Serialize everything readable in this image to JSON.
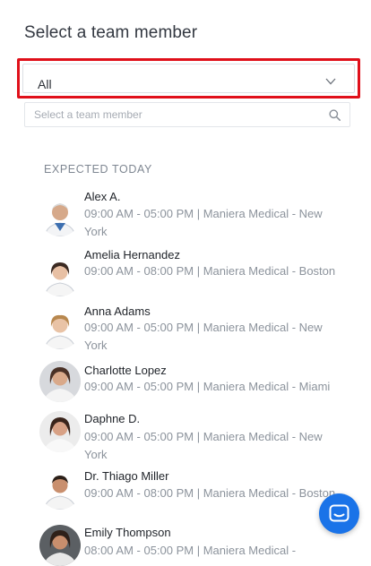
{
  "title": "Select a team member",
  "select": {
    "value": "All",
    "icon": "chevron-down-icon"
  },
  "search": {
    "placeholder": "Select a team member",
    "icon": "search-icon"
  },
  "section_label": "EXPECTED TODAY",
  "members": [
    {
      "name": "Alex A.",
      "detail": "09:00 AM - 05:00 PM | Maniera Medical - New York"
    },
    {
      "name": "Amelia Hernandez",
      "detail": "09:00 AM - 08:00 PM | Maniera Medical - Boston"
    },
    {
      "name": "Anna Adams",
      "detail": "09:00 AM - 05:00 PM | Maniera Medical - New York"
    },
    {
      "name": "Charlotte Lopez",
      "detail": "09:00 AM - 05:00 PM | Maniera Medical - Miami"
    },
    {
      "name": "Daphne D.",
      "detail": "09:00 AM - 05:00 PM | Maniera Medical - New York"
    },
    {
      "name": "Dr. Thiago Miller",
      "detail": "09:00 AM - 08:00 PM | Maniera Medical - Boston"
    },
    {
      "name": "Emily Thompson",
      "detail": "08:00 AM - 05:00 PM | Maniera Medical -"
    }
  ],
  "chat_button": {
    "icon": "chat-icon",
    "color": "#1a73e8"
  },
  "colors": {
    "highlight_border": "#e0101a",
    "muted_text": "#8c939c"
  }
}
